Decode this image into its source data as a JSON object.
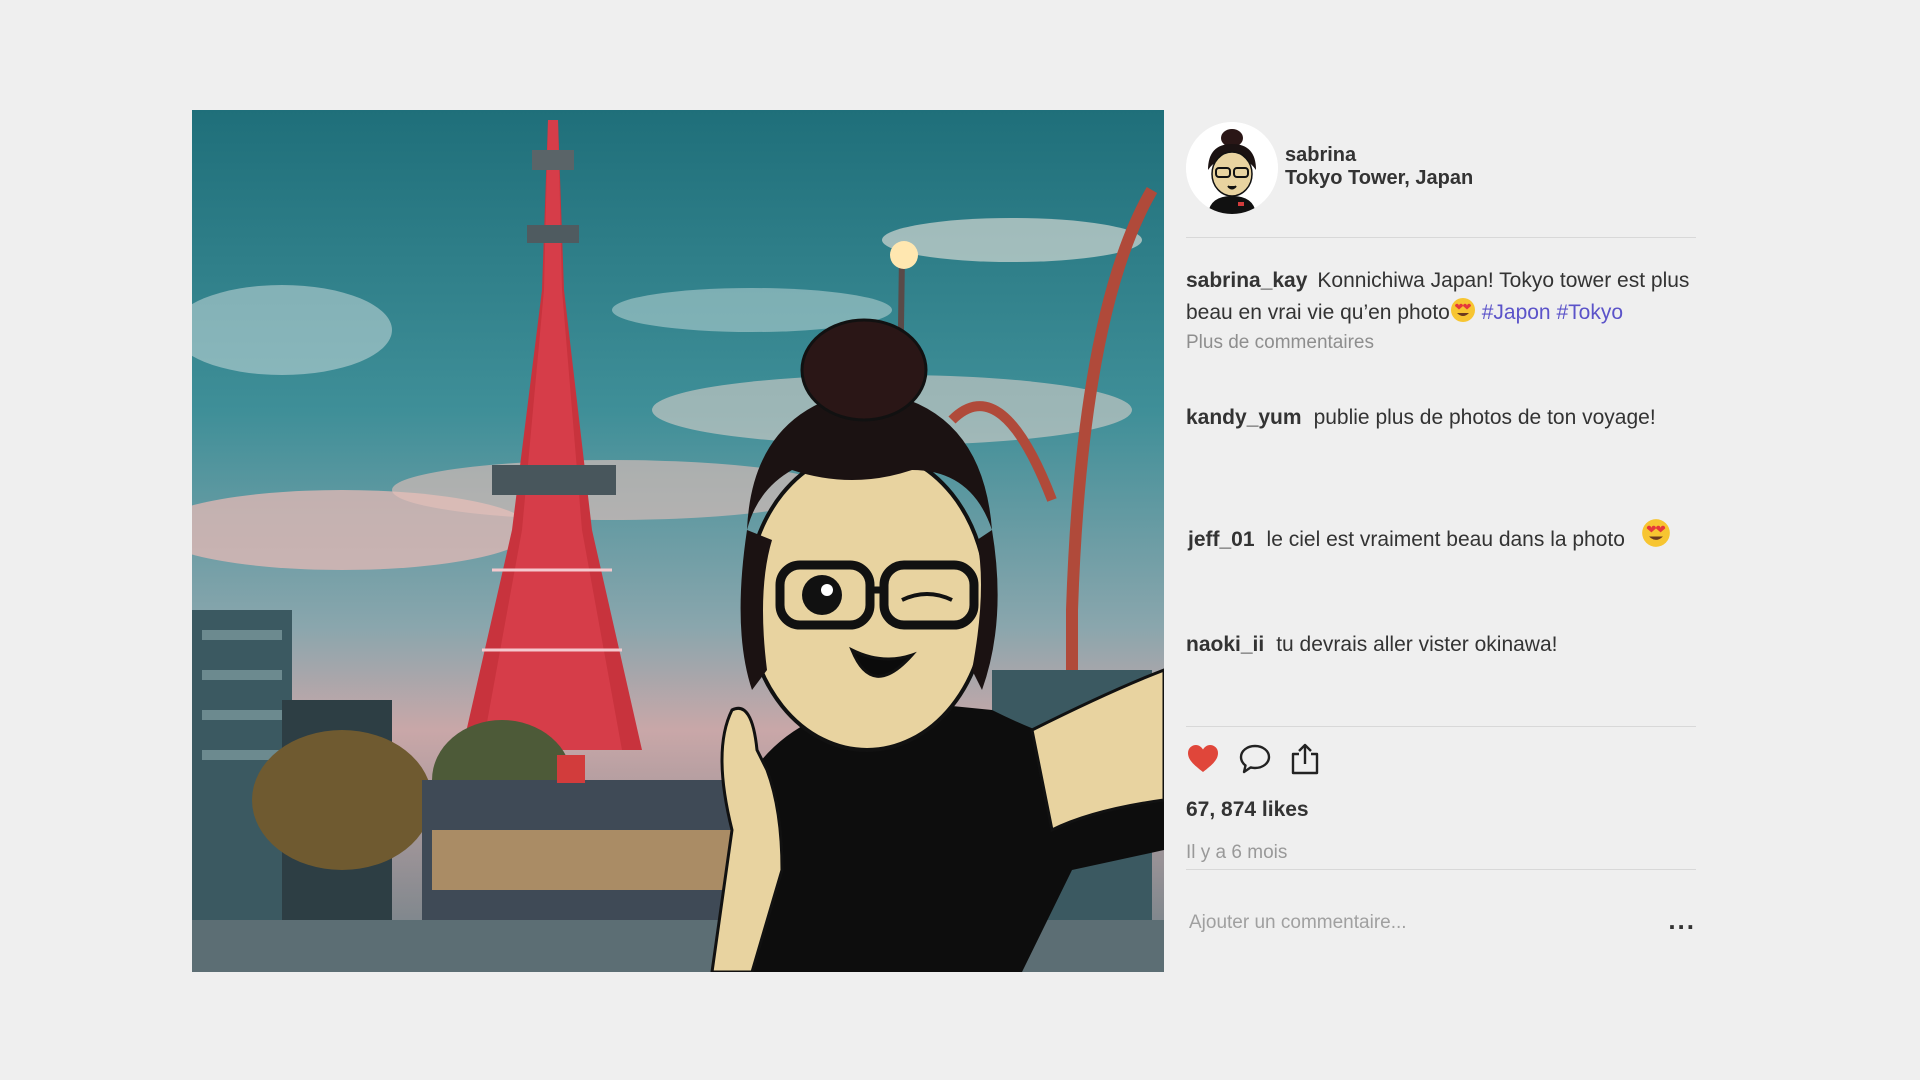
{
  "post": {
    "user_name": "sabrina",
    "location": "Tokyo Tower, Japan",
    "avatar_icon": "girl-avatar",
    "photo_description_icon": "tokyo-tower-selfie-photo"
  },
  "caption": {
    "handle": "sabrina_kay",
    "text": "Konnichiwa Japan! Tokyo tower est plus beau en vrai vie qu’en photo",
    "emoji": "heart-eyes-emoji",
    "hashtags": [
      "#Japon",
      "#Tokyo"
    ]
  },
  "more_comments_label": "Plus de commentaires",
  "comments": [
    {
      "handle": "kandy_yum",
      "text": "publie plus de photos de ton voyage!"
    },
    {
      "handle": "jeff_01",
      "text": "le ciel est vraiment beau dans la photo",
      "emoji": "heart-eyes-emoji"
    },
    {
      "handle": "naoki_ii",
      "text": "tu devrais aller vister okinawa!"
    }
  ],
  "actions": {
    "like_icon": "heart-icon",
    "comment_icon": "speech-bubble-icon",
    "share_icon": "share-icon"
  },
  "likes_label": "67, 874 likes",
  "timestamp": "Il y a 6 mois",
  "comment_placeholder": "Ajouter un commentaire...",
  "more_options_label": "...",
  "colors": {
    "background": "#efefef",
    "heart": "#e0463a",
    "hashtag": "#5b53c9",
    "muted_text": "#8e8e8e"
  }
}
